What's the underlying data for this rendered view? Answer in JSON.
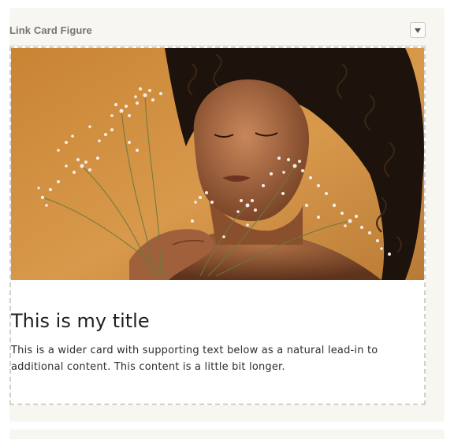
{
  "panel": {
    "title": "Link Card Figure",
    "collapse_icon": "chevron-down-icon"
  },
  "card": {
    "image_alt": "Woman with curly hair holding baby's breath flowers against an orange background",
    "title": "This is my title",
    "text": "This is a wider card with supporting text below as a natural lead-in to additional content. This content is a little bit longer."
  },
  "colors": {
    "panel_background": "#f7f6f1",
    "dashed_border": "#d2d0c8",
    "image_background": "#d28e3a"
  }
}
